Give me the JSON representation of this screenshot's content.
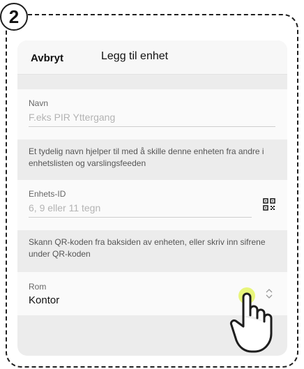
{
  "step_number": "2",
  "header": {
    "cancel_label": "Avbryt",
    "title": "Legg til enhet"
  },
  "name_field": {
    "label": "Navn",
    "placeholder": "F.eks PIR Yttergang",
    "help": "Et tydelig navn hjelper til med å skille denne enheten fra andre i enhetslisten og varslingsfeeden"
  },
  "device_id_field": {
    "label": "Enhets-ID",
    "placeholder": "6, 9 eller 11 tegn",
    "help": "Skann QR-koden fra baksiden av enheten, eller skriv inn sifrene under QR-koden",
    "scan_icon": "qr-code-icon"
  },
  "room_field": {
    "label": "Rom",
    "value": "Kontor",
    "icon": "chevron-up-down-icon"
  },
  "tap_highlight_color": "#e8f57a",
  "pointer_icon": "hand-pointer-icon"
}
